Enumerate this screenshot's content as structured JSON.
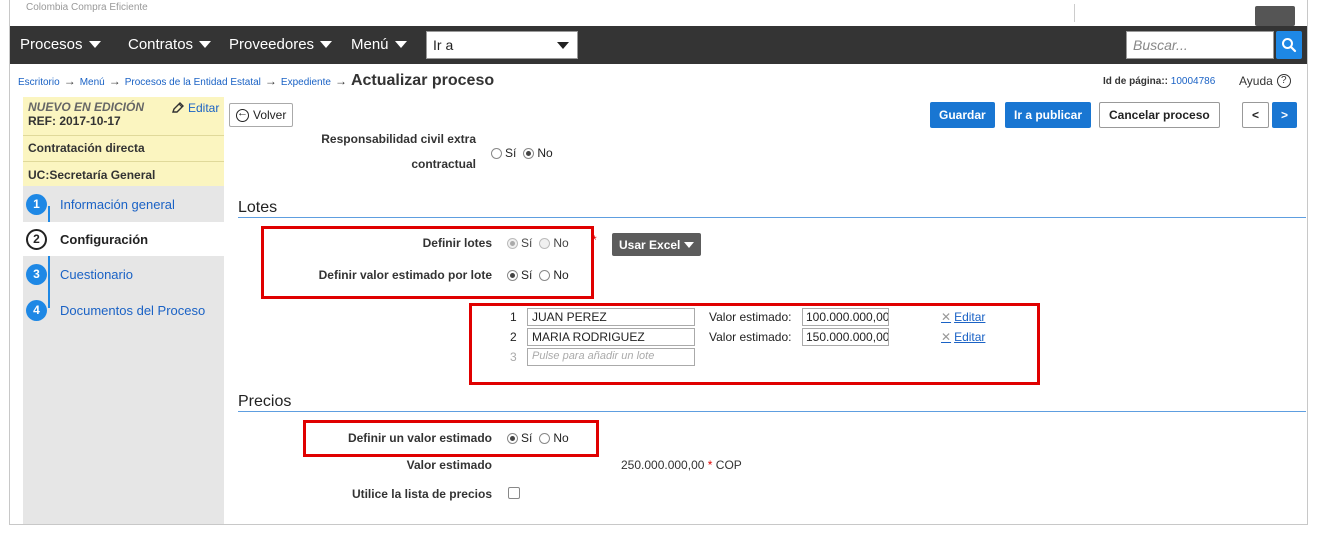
{
  "topbar": {
    "brand": "Colombia Compra Eficiente"
  },
  "nav": {
    "items": [
      "Procesos",
      "Contratos",
      "Proveedores",
      "Menú"
    ],
    "goto": "Ir a",
    "search_placeholder": "Buscar..."
  },
  "breadcrumb": {
    "items": [
      "Escritorio",
      "Menú",
      "Procesos de la Entidad Estatal",
      "Expediente"
    ],
    "current": "Actualizar proceso",
    "arrow": "→"
  },
  "page_id": {
    "label": "Id de página::",
    "value": "10004786"
  },
  "help": {
    "label": "Ayuda",
    "icon": "?"
  },
  "sidebar": {
    "status": "NUEVO EN EDICIÓN",
    "ref": "REF: 2017-10-17",
    "edit": "Editar",
    "type": "Contratación directa",
    "uc": "UC:Secretaría General",
    "steps": [
      {
        "num": "1",
        "label": "Información general"
      },
      {
        "num": "2",
        "label": "Configuración"
      },
      {
        "num": "3",
        "label": "Cuestionario"
      },
      {
        "num": "4",
        "label": "Documentos del Proceso"
      }
    ],
    "active_step": 2
  },
  "toolbar": {
    "back": "Volver",
    "save": "Guardar",
    "publish": "Ir a publicar",
    "cancel": "Cancelar proceso",
    "prev": "<",
    "next": ">"
  },
  "form": {
    "liability_label_1": "Responsabilidad civil extra",
    "liability_label_2": "contractual",
    "yes": "Sí",
    "no": "No",
    "lotes_section": "Lotes",
    "define_lotes": "Definir lotes",
    "define_value_per_lot": "Definir valor estimado por lote",
    "excel": "Usar Excel",
    "lots": [
      {
        "num": "1",
        "name": "JUAN PEREZ",
        "value_label": "Valor estimado:",
        "value": "100.000.000,00",
        "edit": "Editar"
      },
      {
        "num": "2",
        "name": "MARIA RODRIGUEZ",
        "value_label": "Valor estimado:",
        "value": "150.000.000,00",
        "edit": "Editar"
      }
    ],
    "new_lot_num": "3",
    "new_lot_placeholder": "Pulse para añadir un lote",
    "precios_section": "Precios",
    "define_estimated": "Definir un valor estimado",
    "estimated_label": "Valor estimado",
    "estimated_value": "250.000.000,00",
    "currency": "COP",
    "price_list": "Utilice la lista de precios",
    "required_mark": "*"
  },
  "colors": {
    "navbar": "#343434",
    "accent": "#1976d2",
    "highlight": "#e00000",
    "status_bg": "#fbf5c0"
  }
}
